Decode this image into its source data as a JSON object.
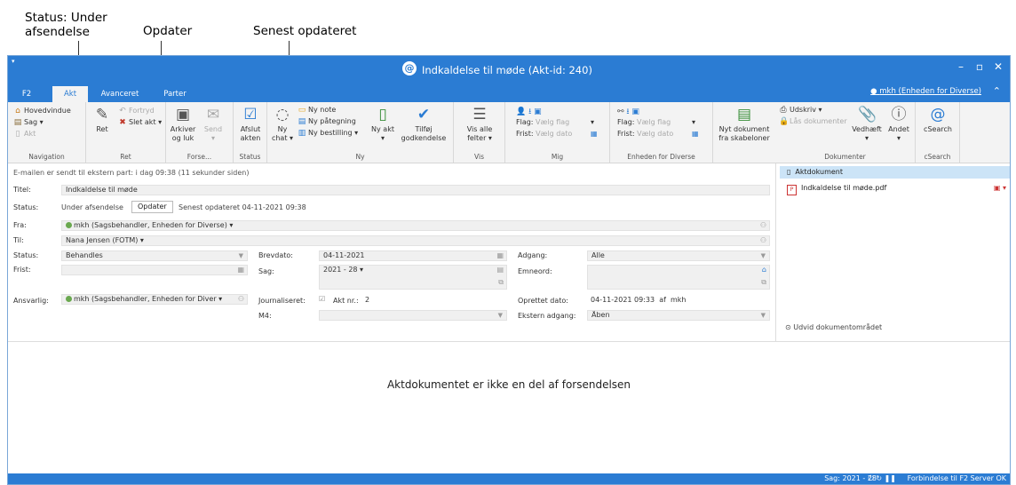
{
  "callouts": {
    "status": "Status: Under afsendelse",
    "opdater": "Opdater",
    "senest": "Senest opdateret"
  },
  "window": {
    "title": "Indkaldelse til møde (Akt-id: 240)",
    "user": "mkh (Enheden for Diverse)"
  },
  "tabs": [
    "F2",
    "Akt",
    "Avanceret",
    "Parter"
  ],
  "ribbon": {
    "navigation": {
      "label": "Navigation",
      "items": [
        "Hovedvindue",
        "Sag",
        "Akt"
      ]
    },
    "ret": {
      "label": "Ret",
      "ret": "Ret",
      "fortryd": "Fortryd",
      "slet": "Slet akt"
    },
    "forse": {
      "label": "Forse...",
      "arkiver": "Arkiver og luk",
      "send": "Send"
    },
    "status": {
      "label": "Status",
      "afslut": "Afslut akten"
    },
    "ny": {
      "label": "Ny",
      "ny_chat": "Ny chat",
      "ny_note": "Ny note",
      "ny_paategning": "Ny påtegning",
      "ny_bestilling": "Ny bestilling",
      "ny_akt": "Ny akt",
      "tilfoej": "Tilføj godkendelse"
    },
    "vis": {
      "label": "Vis",
      "vis_alle": "Vis alle felter"
    },
    "mig": {
      "label": "Mig",
      "flag_lbl": "Flag:",
      "flag_val": "Vælg flag",
      "frist_lbl": "Frist:",
      "frist_val": "Vælg dato"
    },
    "enhed": {
      "label": "Enheden for Diverse",
      "flag_lbl": "Flag:",
      "flag_val": "Vælg flag",
      "frist_lbl": "Frist:",
      "frist_val": "Vælg dato"
    },
    "nyt_dok": "Nyt dokument fra skabeloner",
    "dokumenter": {
      "label": "Dokumenter",
      "udskriv": "Udskriv",
      "laas": "Lås dokumenter",
      "vedhaeft": "Vedhæft",
      "andet": "Andet"
    },
    "csearch": {
      "label": "cSearch",
      "btn": "cSearch"
    }
  },
  "info_line": "E-mailen er sendt til ekstern part:   i dag 09:38 (11 sekunder siden)",
  "form": {
    "titel_lbl": "Titel:",
    "titel": "Indkaldelse til møde",
    "status_lbl": "Status:",
    "status_text": "Under afsendelse",
    "opdater_btn": "Opdater",
    "senest": "Senest opdateret 04-11-2021 09:38",
    "fra_lbl": "Fra:",
    "fra": "mkh (Sagsbehandler, Enheden for Diverse)",
    "til_lbl": "Til:",
    "til": "Nana Jensen (FOTM)",
    "status2_lbl": "Status:",
    "status2": "Behandles",
    "frist_lbl": "Frist:",
    "brevdato_lbl": "Brevdato:",
    "brevdato": "04-11-2021",
    "sag_lbl": "Sag:",
    "sag": "2021 - 28",
    "adgang_lbl": "Adgang:",
    "adgang": "Alle",
    "emneord_lbl": "Emneord:",
    "ansvarlig_lbl": "Ansvarlig:",
    "ansvarlig": "mkh (Sagsbehandler, Enheden for Diver",
    "journal_lbl": "Journaliseret:",
    "akt_nr_lbl": "Akt nr.:",
    "akt_nr": "2",
    "m4_lbl": "M4:",
    "oprettet_lbl": "Oprettet dato:",
    "oprettet": "04-11-2021 09:33",
    "af": "af",
    "af_user": "mkh",
    "ekstern_lbl": "Ekstern adgang:",
    "ekstern": "Åben"
  },
  "documents": {
    "header": "Aktdokument",
    "file": "Indkaldelse til møde.pdf",
    "expand": "Udvid dokumentområdet"
  },
  "preview_message": "Aktdokumentet er ikke en del af forsendelsen",
  "statusbar": {
    "sag": "Sag: 2021 - 28",
    "conn": "Forbindelse til F2 Server OK"
  }
}
